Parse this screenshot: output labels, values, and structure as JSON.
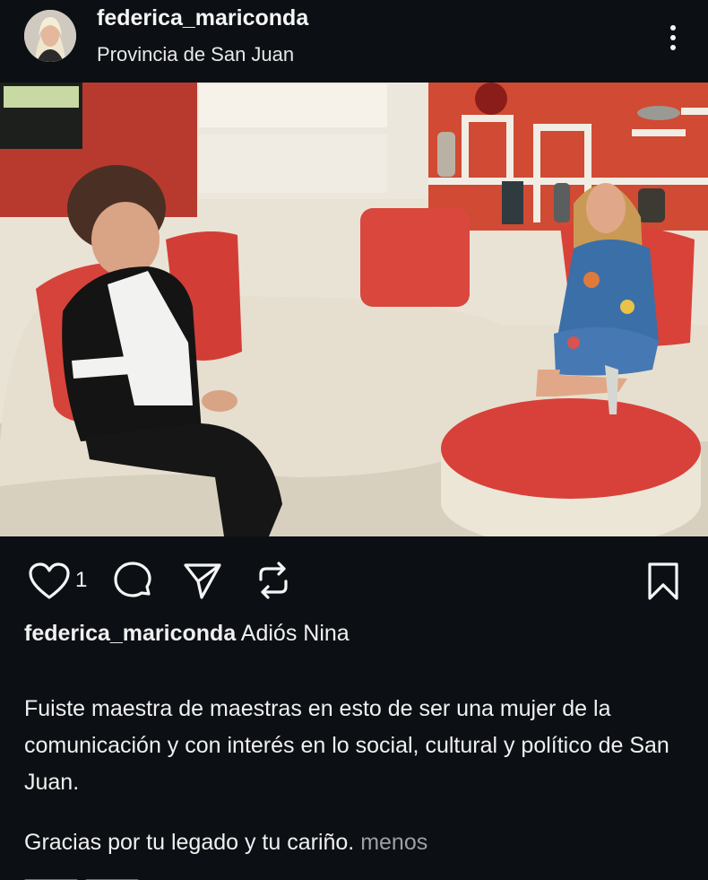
{
  "post": {
    "username": "federica_mariconda",
    "location": "Provincia de San Juan",
    "like_count": "1"
  },
  "caption": {
    "username": "federica_mariconda",
    "headline": "Adiós Nina",
    "body": "Fuiste maestra de maestras en esto de ser una mujer de la comunicación y con interés en lo social, cultural y político de San Juan.",
    "thanks": "Gracias por tu legado y tu cariño.",
    "less_label": "menos"
  },
  "icons": [
    "avatar",
    "more-vertical-icon",
    "heart-icon",
    "comment-icon",
    "share-icon",
    "repost-icon",
    "bookmark-icon"
  ],
  "colors": {
    "background": "#0c1014",
    "text": "#f5f5f5",
    "muted": "#9aa0a6"
  }
}
